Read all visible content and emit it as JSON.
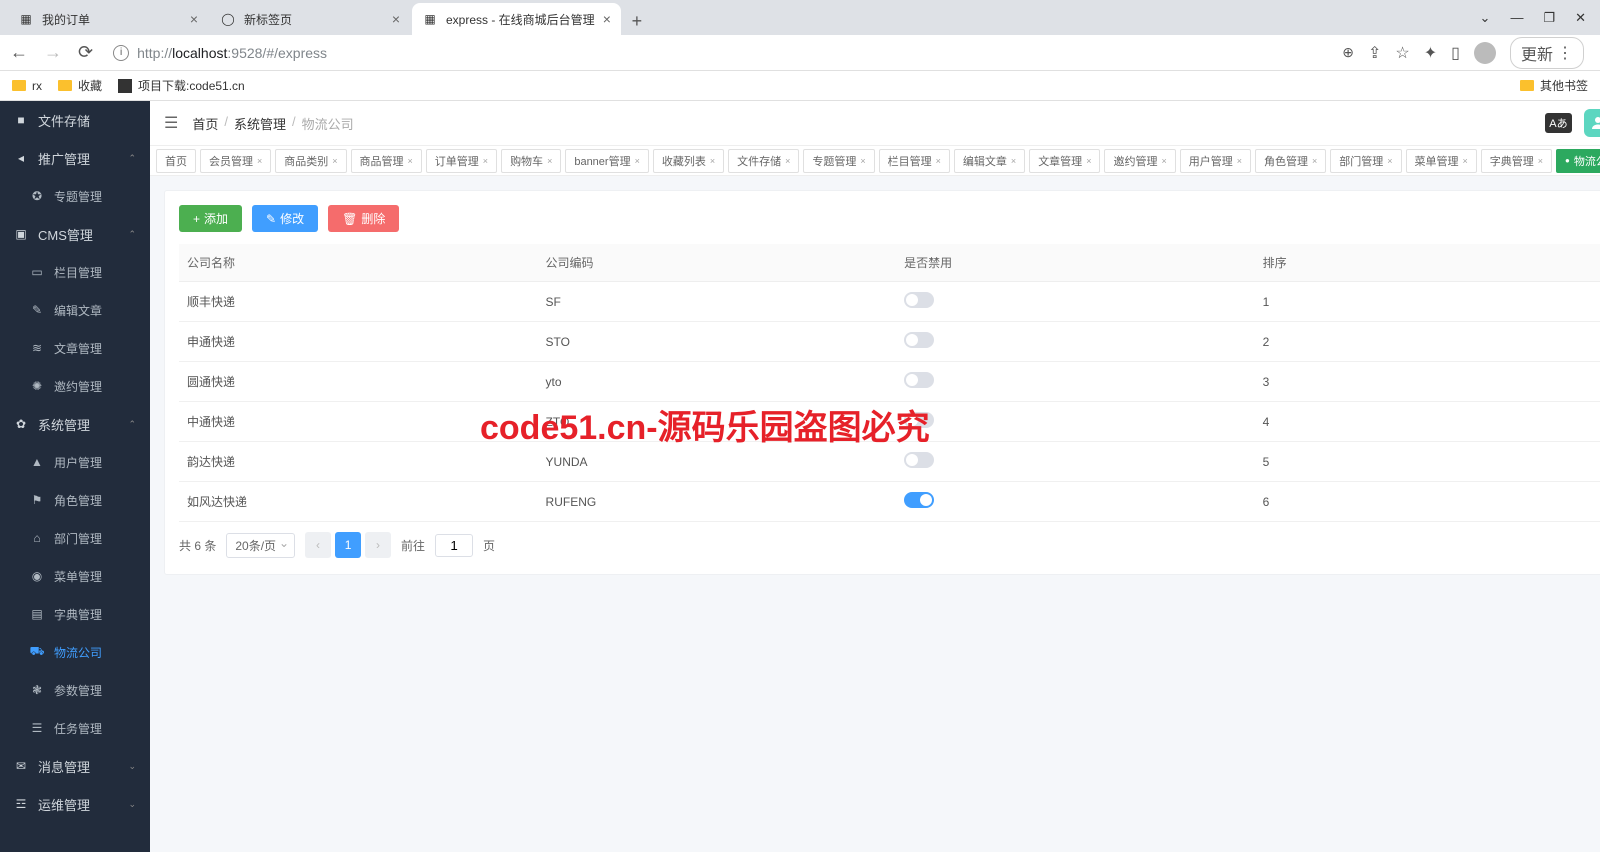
{
  "browser": {
    "tabs": [
      {
        "title": "我的订单",
        "active": false
      },
      {
        "title": "新标签页",
        "active": false
      },
      {
        "title": "express - 在线商城后台管理",
        "active": true
      }
    ],
    "url_prefix": "http://",
    "url_domain": "localhost",
    "url_path": ":9528/#/express",
    "update_label": "更新",
    "bookmarks": {
      "rx": "rx",
      "fav": "收藏",
      "download": "项目下载:code51.cn",
      "other": "其他书签"
    }
  },
  "sidebar": [
    {
      "label": "文件存储",
      "icon": "■",
      "type": "header",
      "chev": ""
    },
    {
      "label": "推广管理",
      "icon": "◂",
      "type": "header",
      "chev": "⌃"
    },
    {
      "label": "专题管理",
      "icon": "✪",
      "type": "sub"
    },
    {
      "label": "CMS管理",
      "icon": "▣",
      "type": "header",
      "chev": "⌃"
    },
    {
      "label": "栏目管理",
      "icon": "▭",
      "type": "sub"
    },
    {
      "label": "编辑文章",
      "icon": "✎",
      "type": "sub"
    },
    {
      "label": "文章管理",
      "icon": "≋",
      "type": "sub"
    },
    {
      "label": "邀约管理",
      "icon": "✺",
      "type": "sub"
    },
    {
      "label": "系统管理",
      "icon": "✿",
      "type": "header",
      "chev": "⌃"
    },
    {
      "label": "用户管理",
      "icon": "▲",
      "type": "sub"
    },
    {
      "label": "角色管理",
      "icon": "⚑",
      "type": "sub"
    },
    {
      "label": "部门管理",
      "icon": "⌂",
      "type": "sub"
    },
    {
      "label": "菜单管理",
      "icon": "◉",
      "type": "sub"
    },
    {
      "label": "字典管理",
      "icon": "▤",
      "type": "sub"
    },
    {
      "label": "物流公司",
      "icon": "⛟",
      "type": "sub",
      "active": true
    },
    {
      "label": "参数管理",
      "icon": "❃",
      "type": "sub"
    },
    {
      "label": "任务管理",
      "icon": "☰",
      "type": "sub"
    },
    {
      "label": "消息管理",
      "icon": "✉",
      "type": "header",
      "chev": "⌄"
    },
    {
      "label": "运维管理",
      "icon": "☲",
      "type": "header",
      "chev": "⌄"
    }
  ],
  "breadcrumb": {
    "home": "首页",
    "section": "系统管理",
    "current": "物流公司"
  },
  "tabs_row": [
    "首页",
    "会员管理",
    "商品类别",
    "商品管理",
    "订单管理",
    "购物车",
    "banner管理",
    "收藏列表",
    "文件存储",
    "专题管理",
    "栏目管理",
    "编辑文章",
    "文章管理",
    "邀约管理",
    "用户管理",
    "角色管理",
    "部门管理",
    "菜单管理",
    "字典管理",
    "物流公司"
  ],
  "tabs_active_index": 19,
  "buttons": {
    "add": "添加",
    "edit": "修改",
    "delete": "删除"
  },
  "table": {
    "headers": {
      "name": "公司名称",
      "code": "公司编码",
      "disabled": "是否禁用",
      "sort": "排序"
    },
    "rows": [
      {
        "name": "顺丰快递",
        "code": "SF",
        "on": false,
        "sort": "1"
      },
      {
        "name": "申通快递",
        "code": "STO",
        "on": false,
        "sort": "2"
      },
      {
        "name": "圆通快递",
        "code": "yto",
        "on": false,
        "sort": "3"
      },
      {
        "name": "中通快递",
        "code": "ZTO",
        "on": false,
        "sort": "4"
      },
      {
        "name": "韵达快递",
        "code": "YUNDA",
        "on": false,
        "sort": "5"
      },
      {
        "name": "如风达快递",
        "code": "RUFENG",
        "on": true,
        "sort": "6"
      }
    ]
  },
  "pagination": {
    "total": "共 6 条",
    "page_size": "20条/页",
    "current": "1",
    "goto_prefix": "前往",
    "goto_value": "1",
    "goto_suffix": "页"
  },
  "watermark": "code51.cn-源码乐园盗图必究",
  "tabs_active_dot": "●"
}
